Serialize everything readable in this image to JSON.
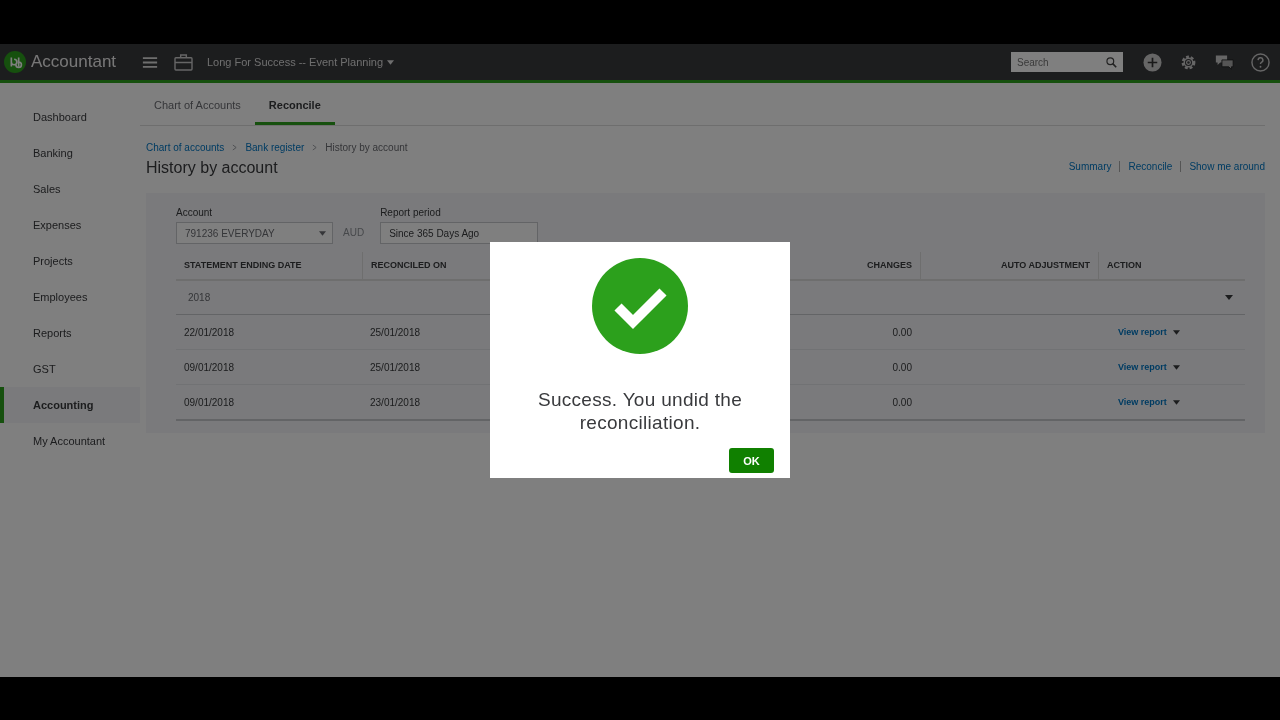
{
  "topbar": {
    "brand": "Accountant",
    "company": "Long For Success -- Event Planning",
    "search": {
      "placeholder": "Search"
    }
  },
  "sidebar": {
    "items": [
      {
        "label": "Dashboard",
        "selected": false
      },
      {
        "label": "Banking",
        "selected": false
      },
      {
        "label": "Sales",
        "selected": false
      },
      {
        "label": "Expenses",
        "selected": false
      },
      {
        "label": "Projects",
        "selected": false
      },
      {
        "label": "Employees",
        "selected": false
      },
      {
        "label": "Reports",
        "selected": false
      },
      {
        "label": "GST",
        "selected": false
      },
      {
        "label": "Accounting",
        "selected": true
      },
      {
        "label": "My Accountant",
        "selected": false
      }
    ]
  },
  "tabs": [
    {
      "label": "Chart of Accounts",
      "selected": false
    },
    {
      "label": "Reconcile",
      "selected": true
    }
  ],
  "breadcrumb": {
    "links": [
      "Chart of accounts",
      "Bank register"
    ],
    "current": "History by account"
  },
  "page_title": "History by account",
  "header_links": [
    "Summary",
    "Reconcile",
    "Show me around"
  ],
  "filters": {
    "account_label": "Account",
    "account_value": "791236 EVERYDAY",
    "currency": "AUD",
    "period_label": "Report period",
    "period_value": "Since 365 Days Ago"
  },
  "table": {
    "columns": [
      "STATEMENT ENDING DATE",
      "RECONCILED ON",
      "CHANGES",
      "AUTO ADJUSTMENT",
      "ACTION"
    ],
    "group": "2018",
    "rows": [
      {
        "statement_ending_date": "22/01/2018",
        "reconciled_on": "25/01/2018",
        "changes": "0.00",
        "action": "View report"
      },
      {
        "statement_ending_date": "09/01/2018",
        "reconciled_on": "25/01/2018",
        "changes": "0.00",
        "action": "View report"
      },
      {
        "statement_ending_date": "09/01/2018",
        "reconciled_on": "23/01/2018",
        "changes": "0.00",
        "action": "View report"
      }
    ]
  },
  "dialog": {
    "message": "Success. You undid the reconciliation.",
    "button": "OK"
  }
}
